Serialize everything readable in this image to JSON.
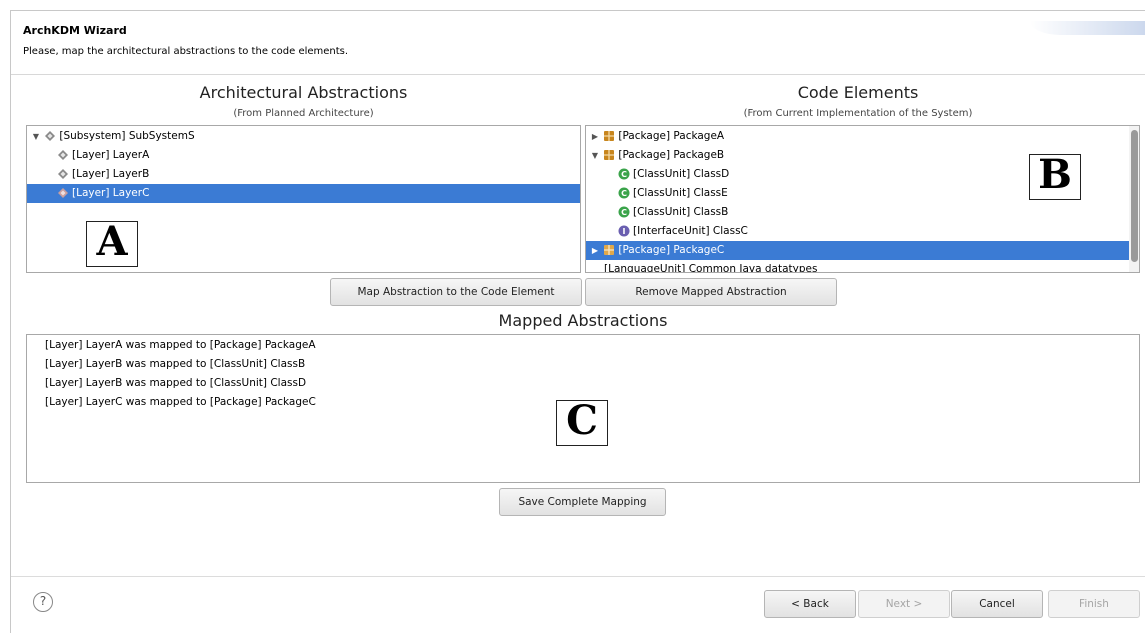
{
  "window": {
    "title": "ArchKDM Wizard",
    "description": "Please, map the architectural abstractions to the code elements."
  },
  "left_panel": {
    "title": "Architectural Abstractions",
    "subtitle": "(From Planned Architecture)",
    "items": [
      {
        "label": "[Subsystem] SubSystemS",
        "icon": "abstraction-diamond-icon",
        "expanded": true
      },
      {
        "label": "[Layer] LayerA",
        "icon": "abstraction-diamond-icon"
      },
      {
        "label": "[Layer] LayerB",
        "icon": "abstraction-diamond-icon"
      },
      {
        "label": "[Layer] LayerC",
        "icon": "abstraction-diamond-icon",
        "selected": true
      }
    ],
    "annotation": "A"
  },
  "right_panel": {
    "title": "Code Elements",
    "subtitle": "(From Current Implementation of the System)",
    "items": [
      {
        "label": "[Package] PackageA",
        "icon": "package-icon",
        "expanded": false
      },
      {
        "label": "[Package] PackageB",
        "icon": "package-icon",
        "expanded": true
      },
      {
        "label": "[ClassUnit] ClassD",
        "icon": "class-icon"
      },
      {
        "label": "[ClassUnit] ClassE",
        "icon": "class-icon"
      },
      {
        "label": "[ClassUnit] ClassB",
        "icon": "class-icon"
      },
      {
        "label": "[InterfaceUnit] ClassC",
        "icon": "interface-icon"
      },
      {
        "label": "[Package] PackageC",
        "icon": "package-icon",
        "selected": true,
        "expanded": false
      },
      {
        "label": "[LanguageUnit] Common Java datatypes",
        "icon": ""
      }
    ],
    "annotation": "B"
  },
  "buttons": {
    "map": "Map Abstraction to the Code Element",
    "remove": "Remove Mapped Abstraction",
    "save": "Save Complete Mapping",
    "back": "< Back",
    "next": "Next >",
    "cancel": "Cancel",
    "finish": "Finish"
  },
  "mapped": {
    "title": "Mapped Abstractions",
    "items": [
      "[Layer] LayerA was mapped to [Package] PackageA",
      "[Layer] LayerB was mapped to [ClassUnit] ClassB",
      "[Layer] LayerB was mapped to [ClassUnit] ClassD",
      "[Layer] LayerC was mapped to [Package] PackageC"
    ],
    "annotation": "C"
  },
  "help": {
    "glyph": "?"
  },
  "colors": {
    "selection": "#3b7bd4",
    "package": "#c8861e",
    "class": "#3aa34a",
    "interface": "#6a5fb0"
  }
}
